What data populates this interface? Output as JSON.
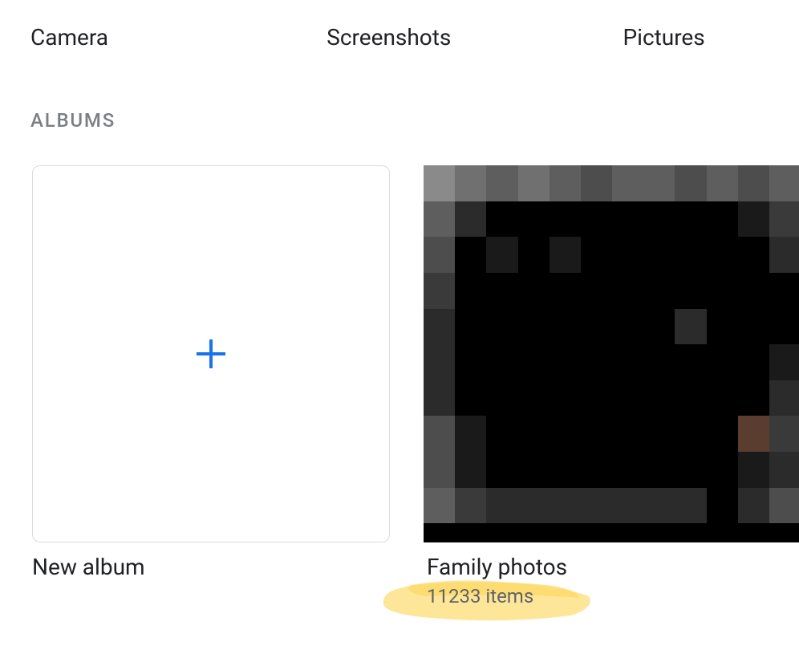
{
  "device_folders": [
    {
      "label": "Camera"
    },
    {
      "label": "Screenshots"
    },
    {
      "label": "Pictures"
    }
  ],
  "section_heading": "ALBUMS",
  "albums": {
    "new": {
      "title": "New album"
    },
    "family": {
      "title": "Family photos",
      "count_text": "11233 items"
    }
  },
  "colors": {
    "plus_icon": "#1a73e8",
    "highlight": "#fde591"
  }
}
